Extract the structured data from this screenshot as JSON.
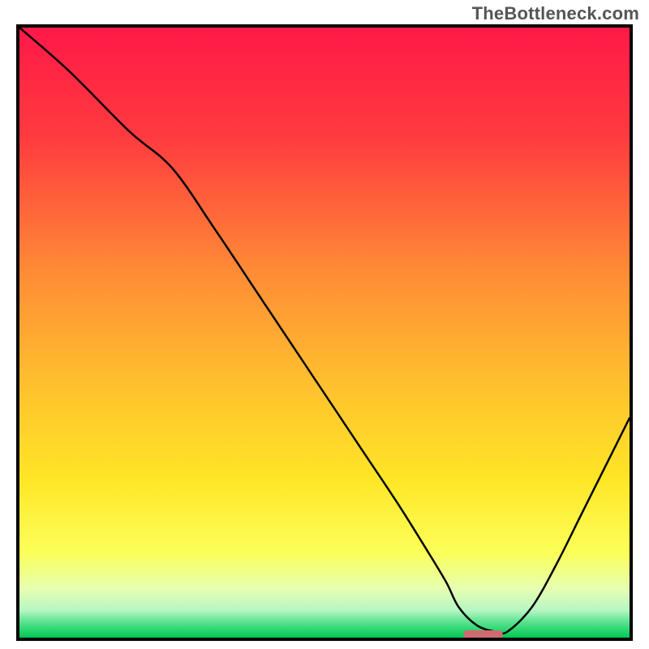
{
  "watermark": "TheBottleneck.com",
  "chart_data": {
    "type": "line",
    "title": "",
    "xlabel": "",
    "ylabel": "",
    "xlim": [
      0,
      100
    ],
    "ylim": [
      0,
      100
    ],
    "grid": false,
    "legend": false,
    "background_gradient": {
      "orientation": "vertical",
      "stops": [
        {
          "pos": 0.0,
          "color": "#ff1948"
        },
        {
          "pos": 0.18,
          "color": "#ff3b3f"
        },
        {
          "pos": 0.4,
          "color": "#ff8b36"
        },
        {
          "pos": 0.58,
          "color": "#ffbf2e"
        },
        {
          "pos": 0.74,
          "color": "#ffe626"
        },
        {
          "pos": 0.86,
          "color": "#fbff59"
        },
        {
          "pos": 0.92,
          "color": "#e6ffb0"
        },
        {
          "pos": 0.955,
          "color": "#b6f7c4"
        },
        {
          "pos": 0.975,
          "color": "#57e28d"
        },
        {
          "pos": 1.0,
          "color": "#00c853"
        }
      ]
    },
    "series": [
      {
        "name": "bottleneck-curve",
        "color": "#000000",
        "width": 2.5,
        "x": [
          0,
          8,
          18,
          25,
          32,
          40,
          48,
          56,
          62,
          67,
          70,
          72,
          75,
          78,
          80,
          84,
          88,
          92,
          96,
          100
        ],
        "y": [
          100,
          93,
          83,
          77,
          67,
          55,
          43,
          31,
          22,
          14,
          9,
          5,
          2,
          1,
          1,
          5,
          12,
          20,
          28,
          36
        ]
      }
    ],
    "marker": {
      "name": "optimal-point",
      "shape": "pill",
      "color": "#d06a70",
      "cx": 76,
      "cy": 0.5,
      "width": 6.5,
      "height": 1.4
    }
  }
}
